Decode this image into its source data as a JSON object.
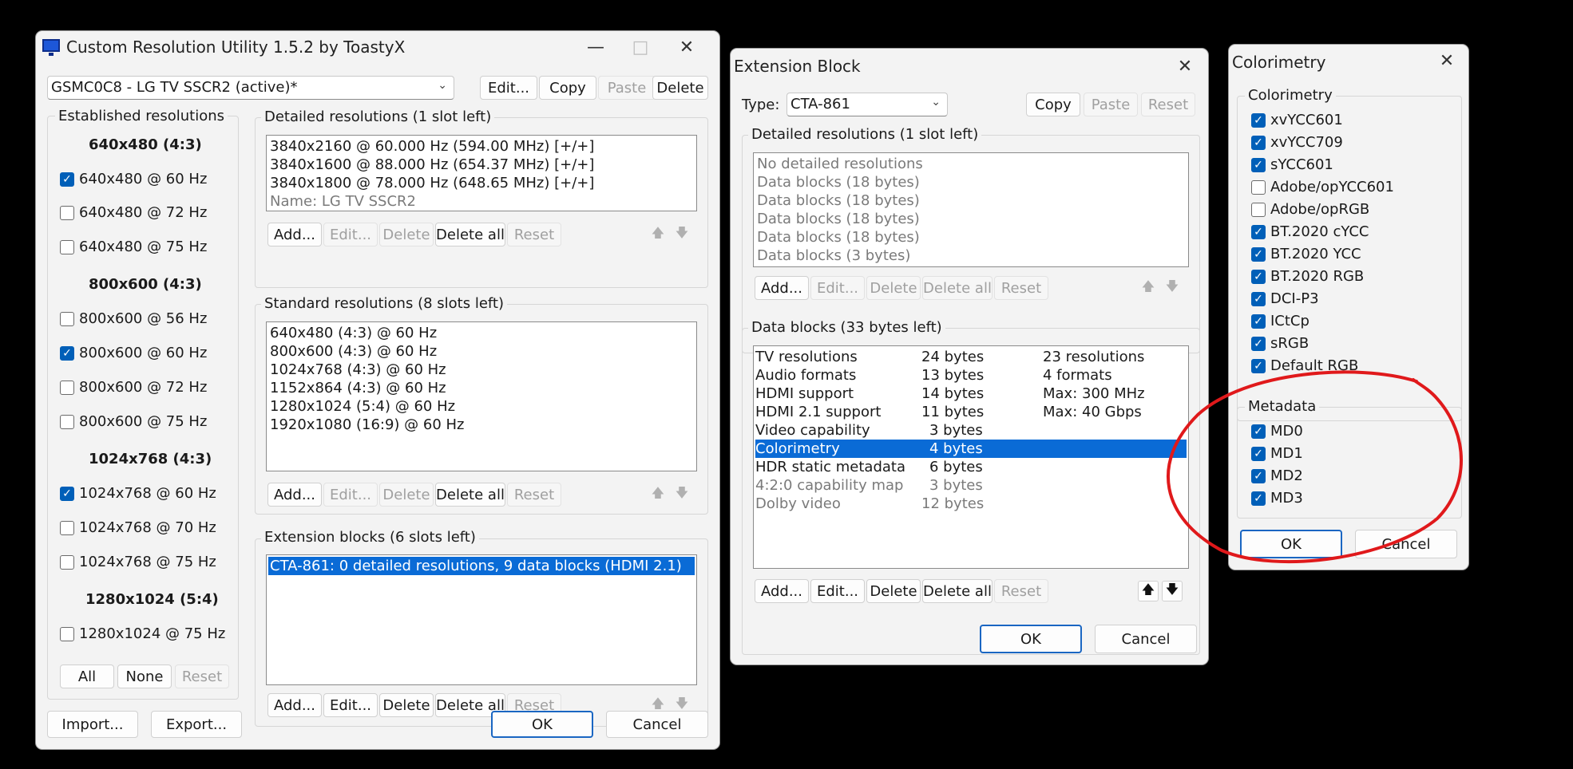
{
  "cru": {
    "title": "Custom Resolution Utility 1.5.2 by ToastyX",
    "display_select": "GSMC0C8 - LG TV SSCR2 (active)*",
    "top_buttons": {
      "edit": "Edit...",
      "copy": "Copy",
      "paste": "Paste",
      "delete": "Delete"
    },
    "established": {
      "label": "Established resolutions",
      "groups": [
        {
          "header": "640x480 (4:3)",
          "items": [
            {
              "label": "640x480 @ 60 Hz",
              "checked": true
            },
            {
              "label": "640x480 @ 72 Hz",
              "checked": false
            },
            {
              "label": "640x480 @ 75 Hz",
              "checked": false
            }
          ]
        },
        {
          "header": "800x600 (4:3)",
          "items": [
            {
              "label": "800x600 @ 56 Hz",
              "checked": false
            },
            {
              "label": "800x600 @ 60 Hz",
              "checked": true
            },
            {
              "label": "800x600 @ 72 Hz",
              "checked": false
            },
            {
              "label": "800x600 @ 75 Hz",
              "checked": false
            }
          ]
        },
        {
          "header": "1024x768 (4:3)",
          "items": [
            {
              "label": "1024x768 @ 60 Hz",
              "checked": true
            },
            {
              "label": "1024x768 @ 70 Hz",
              "checked": false
            },
            {
              "label": "1024x768 @ 75 Hz",
              "checked": false
            }
          ]
        },
        {
          "header": "1280x1024 (5:4)",
          "items": [
            {
              "label": "1280x1024 @ 75 Hz",
              "checked": false
            }
          ]
        }
      ],
      "buttons": {
        "all": "All",
        "none": "None",
        "reset": "Reset"
      }
    },
    "detailed": {
      "label": "Detailed resolutions (1 slot left)",
      "items": [
        "3840x2160 @ 60.000 Hz (594.00 MHz) [+/+]",
        "3840x1600 @ 88.000 Hz (654.37 MHz) [+/+]",
        "3840x1800 @ 78.000 Hz (648.65 MHz) [+/+]"
      ],
      "name_line": "Name: LG TV SSCR2"
    },
    "standard": {
      "label": "Standard resolutions (8 slots left)",
      "items": [
        "640x480 (4:3) @ 60 Hz",
        "800x600 (4:3) @ 60 Hz",
        "1024x768 (4:3) @ 60 Hz",
        "1152x864 (4:3) @ 60 Hz",
        "1280x1024 (5:4) @ 60 Hz",
        "1920x1080 (16:9) @ 60 Hz"
      ]
    },
    "extension": {
      "label": "Extension blocks (6 slots left)",
      "items": [
        "CTA-861: 0 detailed resolutions, 9 data blocks (HDMI 2.1)"
      ]
    },
    "list_buttons": {
      "add": "Add...",
      "edit": "Edit...",
      "delete": "Delete",
      "delete_all": "Delete all",
      "reset": "Reset"
    },
    "arrows": {
      "up": "🡅",
      "down": "🡇"
    },
    "bottom": {
      "import": "Import...",
      "export": "Export...",
      "ok": "OK",
      "cancel": "Cancel"
    }
  },
  "ext": {
    "title": "Extension Block",
    "type_label": "Type:",
    "type_value": "CTA-861",
    "buttons": {
      "copy": "Copy",
      "paste": "Paste",
      "reset": "Reset"
    },
    "detailed": {
      "label": "Detailed resolutions (1 slot left)",
      "items": [
        "No detailed resolutions",
        "Data blocks (18 bytes)",
        "Data blocks (18 bytes)",
        "Data blocks (18 bytes)",
        "Data blocks (18 bytes)",
        "Data blocks (3 bytes)"
      ]
    },
    "datablocks": {
      "label": "Data blocks (33 bytes left)",
      "rows": [
        {
          "name": "TV resolutions",
          "size": "24 bytes",
          "info": "23 resolutions"
        },
        {
          "name": "Audio formats",
          "size": "13 bytes",
          "info": "4 formats"
        },
        {
          "name": "HDMI support",
          "size": "14 bytes",
          "info": "Max: 300 MHz"
        },
        {
          "name": "HDMI 2.1 support",
          "size": "11 bytes",
          "info": "Max: 40 Gbps"
        },
        {
          "name": "Video capability",
          "size": "3 bytes",
          "info": ""
        },
        {
          "name": "Colorimetry",
          "size": "4 bytes",
          "info": ""
        },
        {
          "name": "HDR static metadata",
          "size": "6 bytes",
          "info": ""
        },
        {
          "name": "4:2:0 capability map",
          "size": "3 bytes",
          "info": ""
        },
        {
          "name": "Dolby video",
          "size": "12 bytes",
          "info": ""
        }
      ]
    },
    "list_buttons": {
      "add": "Add...",
      "edit": "Edit...",
      "delete": "Delete",
      "delete_all": "Delete all",
      "reset": "Reset"
    },
    "bottom": {
      "ok": "OK",
      "cancel": "Cancel"
    }
  },
  "color": {
    "title": "Colorimetry",
    "colorimetry_label": "Colorimetry",
    "colorimetry_items": [
      {
        "label": "xvYCC601",
        "checked": true
      },
      {
        "label": "xvYCC709",
        "checked": true
      },
      {
        "label": "sYCC601",
        "checked": true
      },
      {
        "label": "Adobe/opYCC601",
        "checked": false
      },
      {
        "label": "Adobe/opRGB",
        "checked": false
      },
      {
        "label": "BT.2020 cYCC",
        "checked": true
      },
      {
        "label": "BT.2020 YCC",
        "checked": true
      },
      {
        "label": "BT.2020 RGB",
        "checked": true
      },
      {
        "label": "DCI-P3",
        "checked": true
      },
      {
        "label": "ICtCp",
        "checked": true
      },
      {
        "label": "sRGB",
        "checked": true
      },
      {
        "label": "Default RGB",
        "checked": true
      }
    ],
    "metadata_label": "Metadata",
    "metadata_items": [
      {
        "label": "MD0",
        "checked": true
      },
      {
        "label": "MD1",
        "checked": true
      },
      {
        "label": "MD2",
        "checked": true
      },
      {
        "label": "MD3",
        "checked": true
      }
    ],
    "bottom": {
      "ok": "OK",
      "cancel": "Cancel"
    }
  },
  "annotation": {
    "color": "#e0191b"
  },
  "colors": {
    "selection": "#0a6bd6",
    "checkbox": "#005fb8",
    "default_border": "#1a66c2"
  }
}
